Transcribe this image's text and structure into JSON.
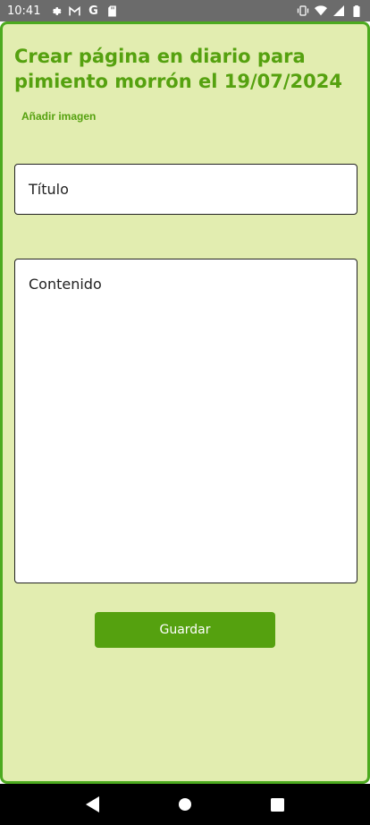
{
  "status_bar": {
    "time": "10:41",
    "left_icons": [
      "gear-icon",
      "gmail-icon",
      "google-icon",
      "sd-card-icon"
    ],
    "right_icons": [
      "vibrate-icon",
      "wifi-icon",
      "signal-icon",
      "battery-icon"
    ]
  },
  "form": {
    "title": "Crear página en diario para pimiento morrón el 19/07/2024",
    "add_image_label": "Añadir imagen",
    "title_field_placeholder": "Título",
    "content_field_placeholder": "Contenido",
    "save_label": "Guardar"
  },
  "colors": {
    "accent": "#55a10f",
    "background": "#e2edb0",
    "border": "#4caa1f"
  },
  "navbar": {
    "buttons": [
      "back-icon",
      "home-icon",
      "recents-icon"
    ]
  }
}
